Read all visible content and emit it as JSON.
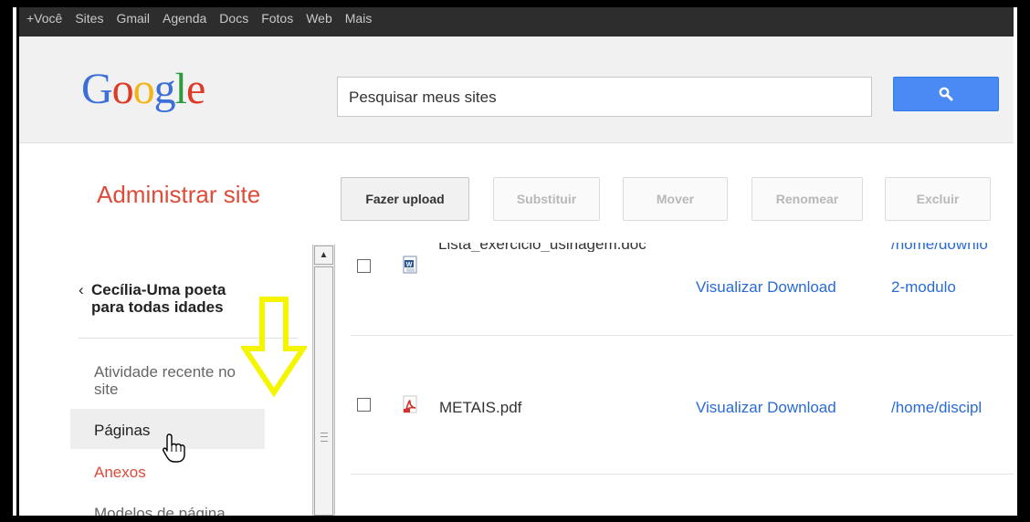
{
  "topbar": {
    "nav_items": [
      "+Você",
      "Sites",
      "Gmail",
      "Agenda",
      "Docs",
      "Fotos",
      "Web",
      "Mais"
    ]
  },
  "logo": {
    "text": "Google",
    "letters": [
      "G",
      "o",
      "o",
      "g",
      "l",
      "e"
    ]
  },
  "search": {
    "placeholder": "Pesquisar meus sites",
    "button_icon": "search-icon"
  },
  "page": {
    "title": "Administrar site"
  },
  "toolbar": {
    "upload_label": "Fazer upload",
    "replace_label": "Substituir",
    "move_label": "Mover",
    "rename_label": "Renomear",
    "delete_label": "Excluir"
  },
  "sidebar": {
    "back_line1": "Cecília-Uma poeta",
    "back_line2": "para todas idades",
    "items": [
      {
        "label": "Atividade recente no site",
        "line1": "Atividade recente no",
        "line2": "site"
      },
      {
        "label": "Páginas"
      },
      {
        "label": "Anexos"
      },
      {
        "label": "Modelos de página"
      }
    ]
  },
  "files": [
    {
      "name": "Lista_exercicio_usinagem.doc",
      "icon": "word-doc-icon",
      "actions": "Visualizar Download",
      "location": "2-modulo",
      "location_path_partial": "/home/downlo"
    },
    {
      "name": "METAIS.pdf",
      "icon": "pdf-icon",
      "actions": "Visualizar Download",
      "location": "/home/discipl"
    }
  ],
  "colors": {
    "title_red": "#dd4b39",
    "link_blue": "#2a6bd8",
    "search_button_blue": "#4a8af4",
    "annotation_arrow": "#f5f500"
  }
}
